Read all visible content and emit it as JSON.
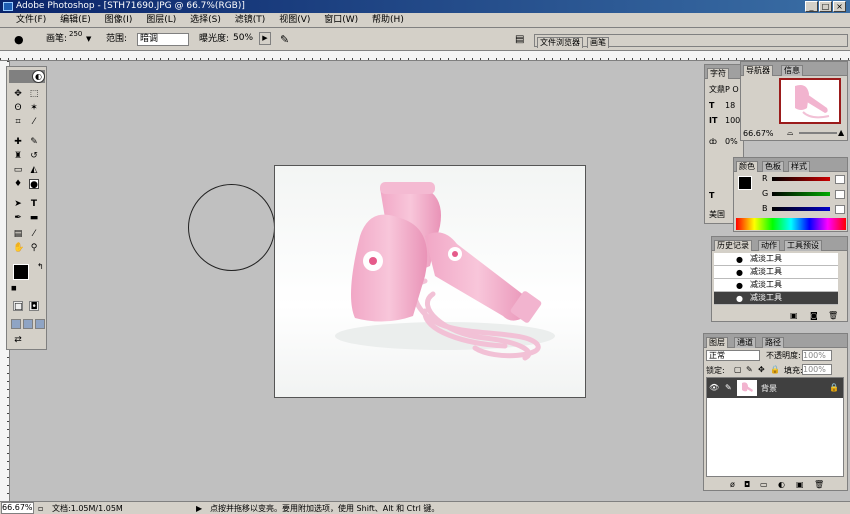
{
  "window": {
    "title": "Adobe Photoshop - [STH71690.JPG @ 66.7%(RGB)]"
  },
  "menu": [
    "文件(F)",
    "编辑(E)",
    "图像(I)",
    "图层(L)",
    "选择(S)",
    "滤镜(T)",
    "视图(V)",
    "窗口(W)",
    "帮助(H)"
  ],
  "options": {
    "brush_label": "画笔:",
    "brush_size": "250",
    "range_label": "范围:",
    "range_value": "暗调",
    "exposure_label": "曝光度:",
    "exposure_value": "50%"
  },
  "palette_well": {
    "tabs": [
      "文件浏览器",
      "画笔"
    ]
  },
  "character": {
    "tabs": [
      "字符"
    ],
    "font_abbrev": "文鼎P O",
    "size_value": "18",
    "leading_value": "100",
    "tracking_value": "0%",
    "lang_abbrev": "美国"
  },
  "navigator": {
    "tabs": [
      "导航器",
      "信息"
    ],
    "zoom": "66.67%"
  },
  "color": {
    "tabs": [
      "颜色",
      "色板",
      "样式"
    ],
    "channels": [
      "R",
      "G",
      "B"
    ],
    "accent": {
      "R": "#cc0000",
      "G": "#00aa00",
      "B": "#0000cc"
    }
  },
  "history": {
    "tabs": [
      "历史记录",
      "动作",
      "工具预设"
    ],
    "items": [
      "减淡工具",
      "减淡工具",
      "减淡工具",
      "减淡工具"
    ],
    "selected_index": 3
  },
  "layers": {
    "tabs": [
      "图层",
      "通道",
      "路径"
    ],
    "blend_mode": "正常",
    "opacity_label": "不透明度:",
    "opacity_value": "100%",
    "lock_label": "锁定:",
    "fill_label": "填充:",
    "fill_value": "100%",
    "layer_name": "背景"
  },
  "status": {
    "zoom": "66.67%",
    "doc": "文档:1.05M/1.05M",
    "hint": "点按并拖移以变亮。要用附加选项，使用 Shift、Alt 和 Ctrl 键。"
  }
}
